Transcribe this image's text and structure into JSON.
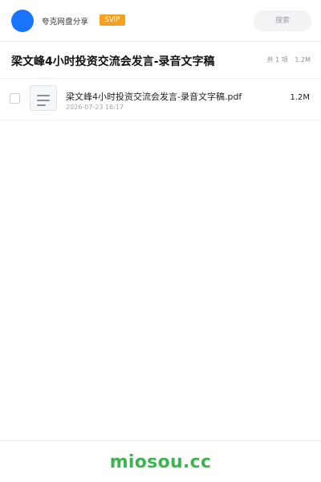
{
  "header": {
    "site_name": "夸克网盘分享",
    "badge": "SVIP",
    "search_placeholder": "搜索",
    "avatar_color": "#1a73ff",
    "badge_color": "#f5a01e"
  },
  "share": {
    "title": "梁文峰4小时投资交流会发言-录音文字稿",
    "item_count": "共 1 项",
    "total_size": "1.2M"
  },
  "files": [
    {
      "name": "梁文峰4小时投资交流会发言-录音文字稿.pdf",
      "date": "2026-07-23 16:17",
      "size": "1.2M",
      "icon": "document-icon"
    }
  ],
  "footer": {
    "brand": "miosou.cc",
    "brand_color": "#3fb34f"
  }
}
